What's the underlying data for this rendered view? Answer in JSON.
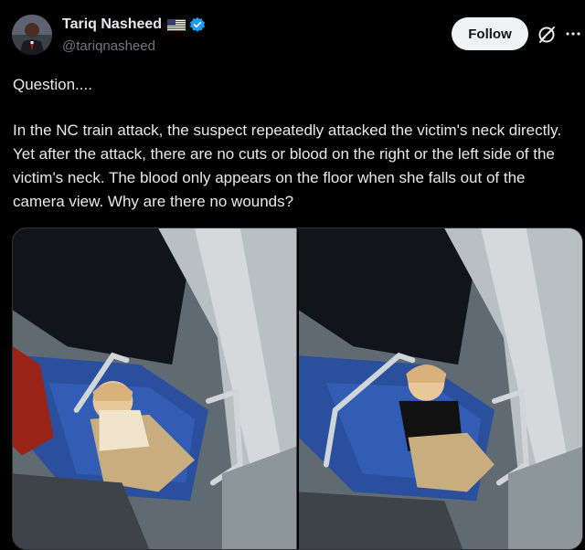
{
  "author": {
    "display_name": "Tariq Nasheed",
    "handle": "@tariqnasheed",
    "verified": true,
    "flag": "US-flag"
  },
  "actions": {
    "follow_label": "Follow",
    "grok_icon": "grok-icon",
    "more_icon": "more-icon"
  },
  "post": {
    "paragraphs": [
      "Question....",
      "In the NC train attack, the suspect repeatedly attacked the victim's neck directly.  Yet after the attack, there are no cuts or blood on the right or the left side of the victim's neck. The blood only appears on the floor when she falls out of the camera view. Why are there no wounds?"
    ]
  },
  "media": {
    "count": 2
  },
  "colors": {
    "background": "#000000",
    "text": "#e7e9ea",
    "secondary_text": "#71767b",
    "verified_blue": "#1d9bf0",
    "follow_bg": "#eff3f4",
    "follow_text": "#0f1419"
  }
}
